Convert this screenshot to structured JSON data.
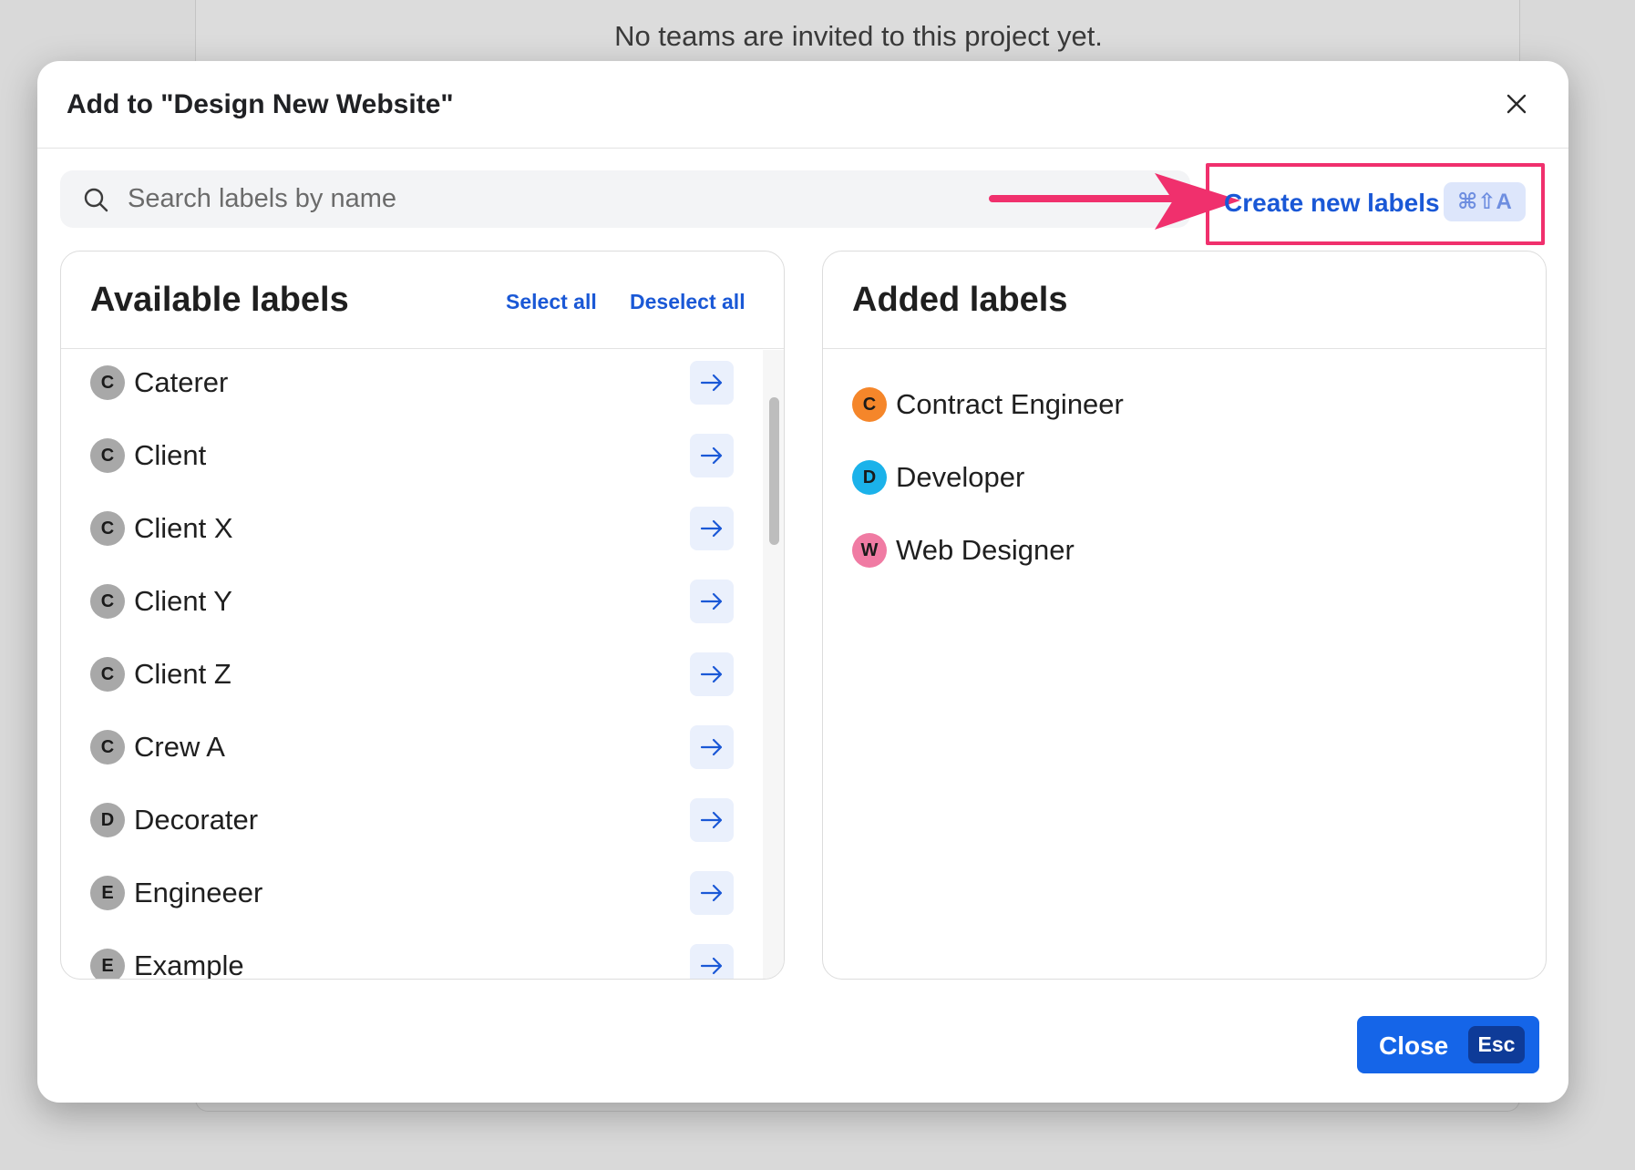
{
  "background": {
    "message": "No teams are invited to this project yet."
  },
  "modal": {
    "title": "Add to \"Design New Website\"",
    "search": {
      "placeholder": "Search labels by name"
    },
    "create_link": "Create new labels",
    "create_shortcut": "⌘⇧A",
    "available": {
      "title": "Available labels",
      "select_all": "Select all",
      "deselect_all": "Deselect all",
      "items": [
        {
          "initial": "C",
          "label": "Caterer"
        },
        {
          "initial": "C",
          "label": "Client"
        },
        {
          "initial": "C",
          "label": "Client X"
        },
        {
          "initial": "C",
          "label": "Client Y"
        },
        {
          "initial": "C",
          "label": "Client Z"
        },
        {
          "initial": "C",
          "label": "Crew A"
        },
        {
          "initial": "D",
          "label": "Decorater"
        },
        {
          "initial": "E",
          "label": "Engineeer"
        },
        {
          "initial": "E",
          "label": "Example"
        }
      ]
    },
    "added": {
      "title": "Added labels",
      "items": [
        {
          "initial": "C",
          "label": "Contract Engineer",
          "color": "#f5862a"
        },
        {
          "initial": "D",
          "label": "Developer",
          "color": "#1bb2ea"
        },
        {
          "initial": "W",
          "label": "Web Designer",
          "color": "#f07ba3"
        }
      ]
    },
    "close_button": {
      "label": "Close",
      "shortcut": "Esc"
    }
  },
  "colors": {
    "accent": "#1565e8",
    "link": "#1a58d6",
    "highlight": "#f0306d",
    "neutral_avatar": "#a8a8a8"
  }
}
